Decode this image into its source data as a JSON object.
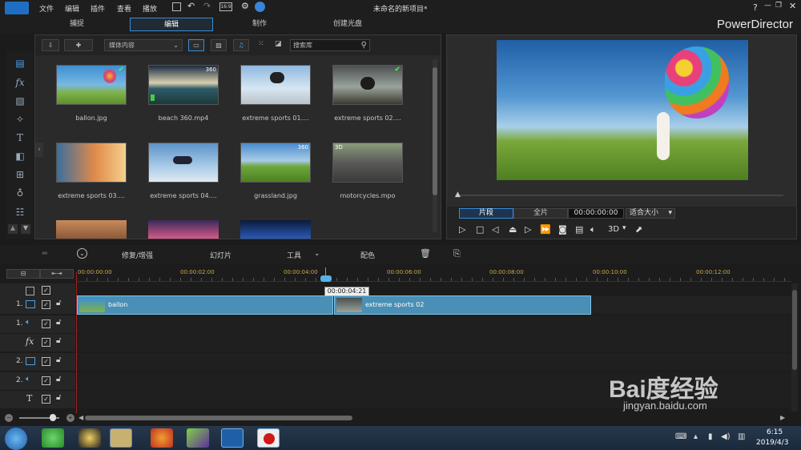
{
  "app": {
    "title": "未命名的新项目*",
    "brand": "PowerDirector",
    "help": "?"
  },
  "menu": [
    "文件",
    "编辑",
    "插件",
    "查看",
    "播放"
  ],
  "modes": [
    "捕捉",
    "编辑",
    "制作",
    "创建光盘"
  ],
  "library": {
    "dropdown": "媒体内容",
    "search_placeholder": "搜索库",
    "items": [
      {
        "name": "ballon.jpg",
        "badge": ""
      },
      {
        "name": "beach 360.mp4",
        "badge": "360"
      },
      {
        "name": "extreme sports 01....",
        "badge": ""
      },
      {
        "name": "extreme sports 02....",
        "badge": ""
      },
      {
        "name": "extreme sports 03....",
        "badge": ""
      },
      {
        "name": "extreme sports 04....",
        "badge": ""
      },
      {
        "name": "grassland.jpg",
        "badge": "360"
      },
      {
        "name": "motorcycles.mpo",
        "badge": "3D"
      }
    ]
  },
  "preview": {
    "tab_clip": "片段",
    "tab_full": "全片",
    "timecode": "00:00:00:00",
    "fit": "适合大小",
    "threed": "3D"
  },
  "timeline_toolbar": {
    "repair": "修复/增强",
    "slideshow": "幻灯片",
    "tools": "工具",
    "color": "配色"
  },
  "ruler": [
    "00:00:00:00",
    "00:00:02:00",
    "00:00:04:00",
    "00:00:06:00",
    "00:00:08:00",
    "00:00:10:00",
    "00:00:12:00"
  ],
  "playhead_tooltip": "00:00:04:21",
  "tracks": [
    {
      "label": "",
      "kind": "master"
    },
    {
      "label": "1.",
      "kind": "video"
    },
    {
      "label": "1.",
      "kind": "audio"
    },
    {
      "label": "fx",
      "kind": "fx"
    },
    {
      "label": "2.",
      "kind": "video"
    },
    {
      "label": "2.",
      "kind": "audio"
    },
    {
      "label": "T",
      "kind": "title"
    }
  ],
  "clips": {
    "clip1": "ballon",
    "clip2": "extreme sports 02"
  },
  "taskbar": {
    "time": "6:15",
    "date": "2019/4/3"
  },
  "watermark": {
    "logo": "Bai度经验",
    "url": "jingyan.baidu.com"
  }
}
